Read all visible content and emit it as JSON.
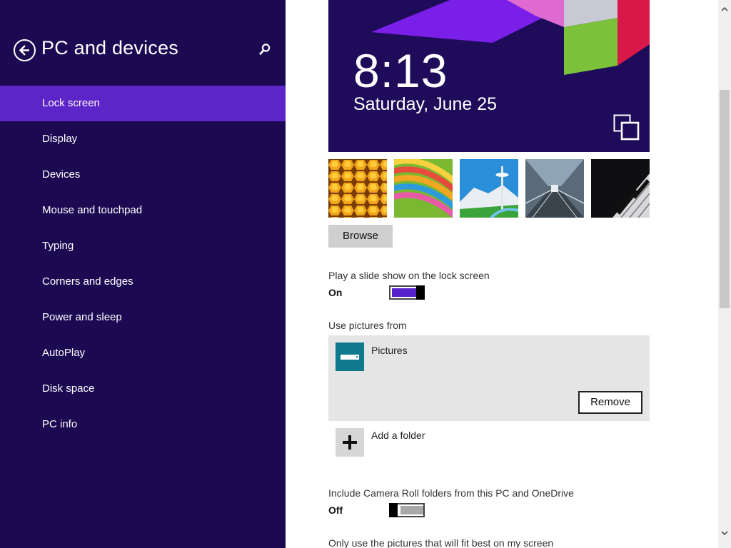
{
  "sidebar": {
    "title": "PC and devices",
    "items": [
      {
        "label": "Lock screen",
        "selected": true
      },
      {
        "label": "Display"
      },
      {
        "label": "Devices"
      },
      {
        "label": "Mouse and touchpad"
      },
      {
        "label": "Typing"
      },
      {
        "label": "Corners and edges"
      },
      {
        "label": "Power and sleep"
      },
      {
        "label": "AutoPlay"
      },
      {
        "label": "Disk space"
      },
      {
        "label": "PC info"
      }
    ]
  },
  "preview": {
    "time": "8:13",
    "date": "Saturday, June 25"
  },
  "main": {
    "browse_label": "Browse",
    "slideshow": {
      "label": "Play a slide show on the lock screen",
      "state": "On"
    },
    "pictures_from": {
      "label": "Use pictures from",
      "folder": "Pictures",
      "remove_label": "Remove"
    },
    "add_folder_label": "Add a folder",
    "camera_roll": {
      "label": "Include Camera Roll folders from this PC and OneDrive",
      "state": "Off"
    },
    "fit_best_label": "Only use the pictures that will fit best on my screen"
  },
  "colors": {
    "sidebar_bg": "#1b0a52",
    "selected_bg": "#5c25c7",
    "accent": "#5522cc",
    "folder_icon": "#0f7a8e"
  },
  "icons": {
    "back": "back-arrow-icon",
    "search": "search-icon",
    "lock_preview": "screen-overlay-icon",
    "folder": "pictures-folder-icon",
    "add": "plus-icon"
  }
}
